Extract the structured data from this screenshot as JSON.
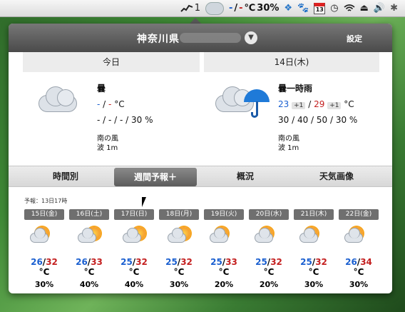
{
  "menubar": {
    "count": "1",
    "temp_low": "-",
    "temp_sep": "/",
    "temp_high": "-",
    "temp_unit": "℃",
    "pop": "30%",
    "calendar_day": "13"
  },
  "header": {
    "location": "神奈川県",
    "settings_label": "設定"
  },
  "today": {
    "label": "今日",
    "condition": "曇",
    "temp_low": "-",
    "temp_high": "-",
    "temp_unit": "°C",
    "pop": "- / - / - / 30 %",
    "wind": "南の風",
    "wave": "波 1m"
  },
  "tomorrow": {
    "label": "14日(木)",
    "condition": "曇一時雨",
    "temp_low": "23",
    "temp_low_diff": "+1",
    "temp_high": "29",
    "temp_high_diff": "+1",
    "temp_unit": "°C",
    "pop": "30 / 40 / 50 / 30 %",
    "wind": "南の風",
    "wave": "波 1m"
  },
  "tabs": [
    {
      "label": "時間別"
    },
    {
      "label": "週間予報＋"
    },
    {
      "label": "概況"
    },
    {
      "label": "天気画像"
    }
  ],
  "weekly": {
    "issued": "予報：13日17時",
    "temp_unit": "°C",
    "days": [
      {
        "label": "15日(金)",
        "low": "26",
        "high": "32",
        "pop": "30%",
        "icon": "sunny-then-cloudy-icon"
      },
      {
        "label": "16日(土)",
        "low": "26",
        "high": "33",
        "pop": "40%",
        "icon": "cloudy-then-sunny-icon"
      },
      {
        "label": "17日(日)",
        "low": "25",
        "high": "32",
        "pop": "40%",
        "icon": "cloudy-then-sunny-icon"
      },
      {
        "label": "18日(月)",
        "low": "25",
        "high": "32",
        "pop": "30%",
        "icon": "cloudy-then-sunny-icon"
      },
      {
        "label": "19日(火)",
        "low": "25",
        "high": "33",
        "pop": "20%",
        "icon": "sunny-then-cloudy-icon"
      },
      {
        "label": "20日(水)",
        "low": "25",
        "high": "32",
        "pop": "20%",
        "icon": "sunny-then-cloudy-icon"
      },
      {
        "label": "21日(木)",
        "low": "25",
        "high": "32",
        "pop": "30%",
        "icon": "sunny-then-cloudy-icon"
      },
      {
        "label": "22日(金)",
        "low": "26",
        "high": "34",
        "pop": "30%",
        "icon": "sunny-then-cloudy-icon"
      }
    ]
  },
  "colors": {
    "low_temp": "#1a5fd0",
    "high_temp": "#c42020",
    "header_bg": "#555555"
  }
}
